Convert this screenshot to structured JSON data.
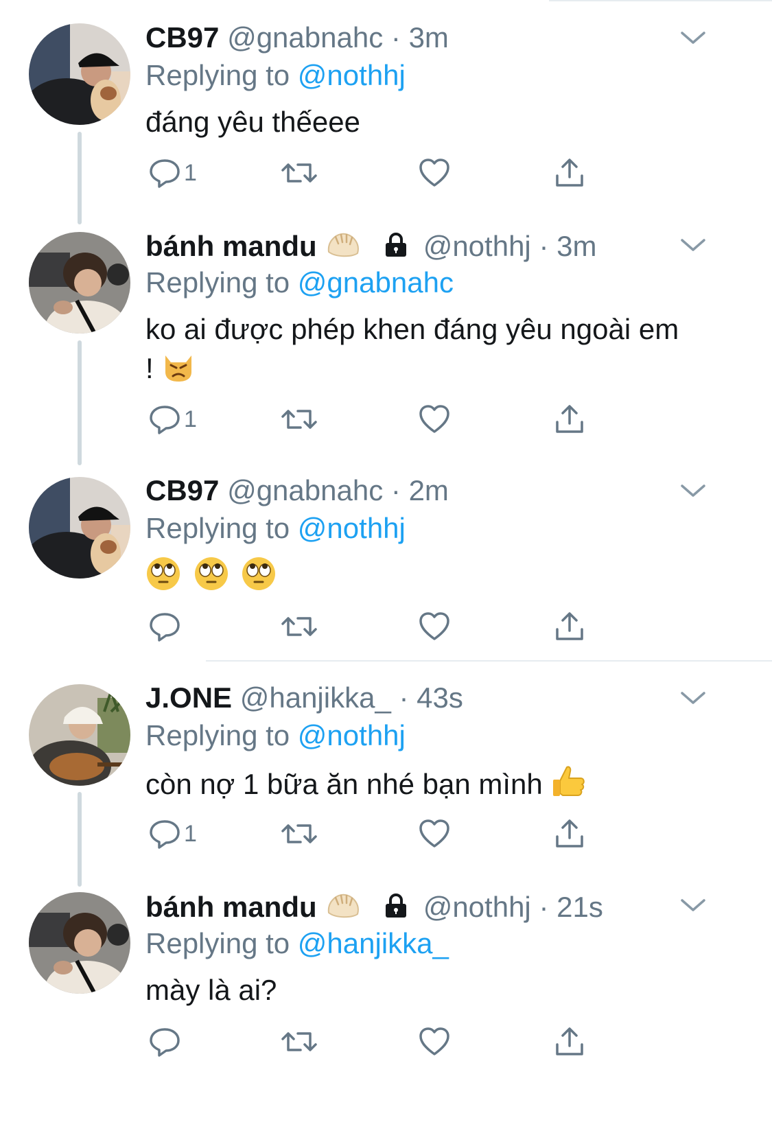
{
  "tweets": [
    {
      "name": "CB97",
      "handle": "@gnabnahc",
      "dot": "·",
      "time": "3m",
      "reply_prefix": "Replying to",
      "reply_to": "@nothhj",
      "text": "đáng yêu thếeee",
      "reply_count": "1",
      "avatar": "avatar-cap-with-dog",
      "emoji": []
    },
    {
      "name": "bánh mandu",
      "handle": "@nothhj",
      "dot": "·",
      "time": "3m",
      "reply_prefix": "Replying to",
      "reply_to": "@gnabnahc",
      "text": "ko ai được phép khen đáng yêu ngoài em !",
      "reply_count": "1",
      "avatar": "avatar-girl-camera",
      "emoji": [
        "dumpling-icon",
        "lock-icon",
        "pouting-cat-icon"
      ]
    },
    {
      "name": "CB97",
      "handle": "@gnabnahc",
      "dot": "·",
      "time": "2m",
      "reply_prefix": "Replying to",
      "reply_to": "@nothhj",
      "text": "",
      "reply_count": "",
      "avatar": "avatar-cap-with-dog",
      "emoji": [
        "eye-roll-icon",
        "eye-roll-icon",
        "eye-roll-icon"
      ]
    },
    {
      "name": "J.ONE",
      "handle": "@hanjikka_",
      "dot": "·",
      "time": "43s",
      "reply_prefix": "Replying to",
      "reply_to": "@nothhj",
      "text": "còn nợ 1 bữa ăn nhé bạn mình",
      "reply_count": "1",
      "avatar": "avatar-guitar",
      "emoji": [
        "thumbs-up-icon"
      ]
    },
    {
      "name": "bánh mandu",
      "handle": "@nothhj",
      "dot": "·",
      "time": "21s",
      "reply_prefix": "Replying to",
      "reply_to": "@hanjikka_",
      "text": "mày là ai?",
      "reply_count": "",
      "avatar": "avatar-girl-camera",
      "emoji": [
        "dumpling-icon",
        "lock-icon"
      ]
    }
  ],
  "icons": {
    "reply": "reply-icon",
    "retweet": "retweet-icon",
    "like": "like-icon",
    "share": "share-icon",
    "more": "chevron-down-icon"
  },
  "colors": {
    "link": "#1da1f2",
    "secondary": "#657786",
    "primary": "#14171a",
    "divider": "#e6ecf0"
  }
}
